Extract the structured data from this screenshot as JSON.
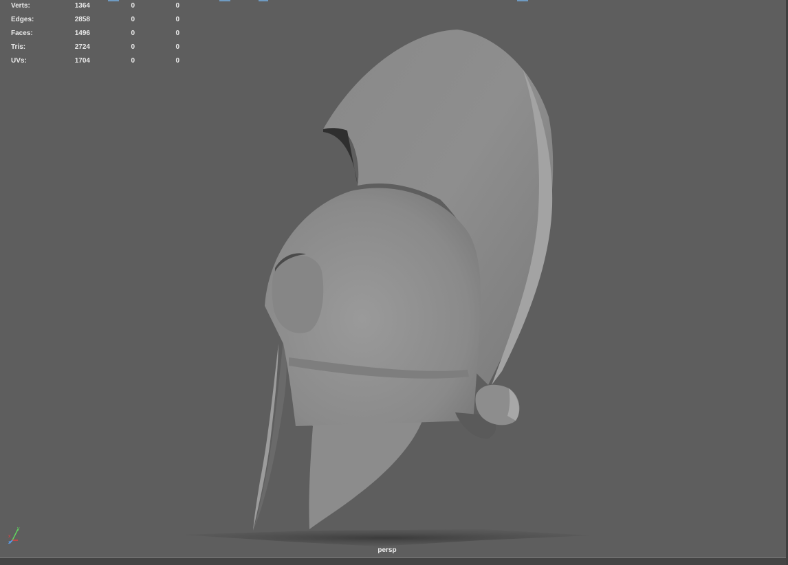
{
  "stats": [
    {
      "label": "Verts:",
      "total": "1364",
      "selected": "0",
      "other": "0"
    },
    {
      "label": "Edges:",
      "total": "2858",
      "selected": "0",
      "other": "0"
    },
    {
      "label": "Faces:",
      "total": "1496",
      "selected": "0",
      "other": "0"
    },
    {
      "label": "Tris:",
      "total": "2724",
      "selected": "0",
      "other": "0"
    },
    {
      "label": "UVs:",
      "total": "1704",
      "selected": "0",
      "other": "0"
    }
  ],
  "viewport": {
    "camera": "persp",
    "background": "#5e5e5e"
  },
  "axis": {
    "y": "y",
    "x": "x",
    "z": "z"
  },
  "colors": {
    "axis_x": "#e04040",
    "axis_y": "#5fd65f",
    "axis_z": "#5aa6ff",
    "accent": "#6f9bc2"
  }
}
